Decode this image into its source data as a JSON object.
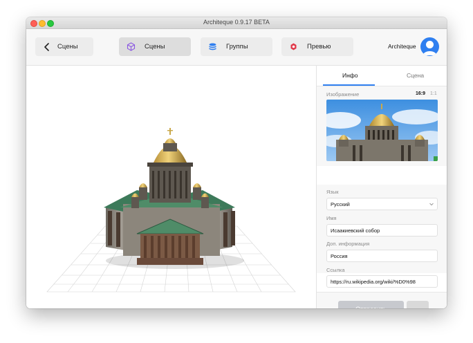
{
  "window": {
    "title": "Architeque 0.9.17 BETA"
  },
  "toolbar": {
    "back_label": "Сцены",
    "nav": [
      {
        "label": "Сцены",
        "icon": "cube-icon",
        "active": true
      },
      {
        "label": "Группы",
        "icon": "layers-icon",
        "active": false
      },
      {
        "label": "Превью",
        "icon": "preview-icon",
        "active": false
      }
    ],
    "username": "Architeque"
  },
  "panel": {
    "tabs": [
      {
        "label": "Инфо",
        "active": true
      },
      {
        "label": "Сцена",
        "active": false
      }
    ],
    "image_label": "Изображение",
    "ratios": [
      "16:9",
      "1:1"
    ],
    "selected_ratio": "16:9",
    "language_label": "Язык",
    "language_value": "Русский",
    "name_label": "Имя",
    "name_value": "Исаакиевский собор",
    "extra_label": "Доп. информация",
    "extra_value": "Россия",
    "link_label": "Ссылка",
    "link_value": "https://ru.wikipedia.org/wiki/%D0%98",
    "submit_label": "Отправить",
    "more_label": "···"
  },
  "colors": {
    "accent": "#2f7ff0",
    "preview_icon": "#e0394a",
    "groups_icon": "#2f7ff0",
    "scenes_icon": "#8a56e2"
  }
}
